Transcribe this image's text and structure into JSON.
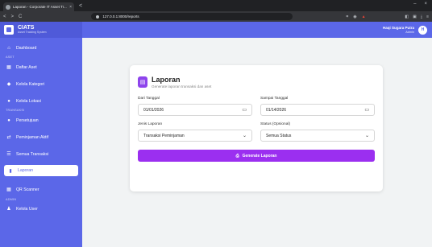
{
  "browser": {
    "tab_title": "Laporan - Corporate IT Asset Tr...",
    "tab_close": "×",
    "new_tab": "<",
    "nav_back": "<",
    "nav_forward": ">",
    "nav_reload": "C",
    "url": "127.0.0.1:8000/reports",
    "window_controls": [
      "–",
      "×"
    ]
  },
  "sidebar": {
    "brand_name": "CIATS",
    "brand_sub": "Asset Tracking System",
    "sections": {
      "asset": "ASET",
      "transaksi": "TRANSAKSI",
      "admin": "ADMIN"
    },
    "items": [
      {
        "label": "Dashboard",
        "icon": "home-icon",
        "glyph": "⌂"
      },
      {
        "label": "Daftar Aset",
        "icon": "boxes-icon",
        "glyph": "▦"
      },
      {
        "label": "Kelola Kategori",
        "icon": "tag-icon",
        "glyph": "◆"
      },
      {
        "label": "Kelola Lokasi",
        "icon": "location-icon",
        "glyph": "●"
      },
      {
        "label": "Persetujuan",
        "icon": "check-circle-icon",
        "glyph": "●"
      },
      {
        "label": "Peminjaman Aktif",
        "icon": "exchange-icon",
        "glyph": "⇄"
      },
      {
        "label": "Semua Transaksi",
        "icon": "list-icon",
        "glyph": "☰"
      },
      {
        "label": "Laporan",
        "icon": "file-icon",
        "glyph": "▮"
      },
      {
        "label": "QR Scanner",
        "icon": "qr-icon",
        "glyph": "▦"
      },
      {
        "label": "Kelola User",
        "icon": "users-icon",
        "glyph": "♟"
      }
    ]
  },
  "topbar": {
    "user_name": "Haqi Sugara Putra",
    "user_role": "Admin",
    "avatar_initial": "H"
  },
  "report": {
    "title": "Laporan",
    "subtitle": "Generate laporan transaksi dan aset",
    "from_label": "Dari Tanggal",
    "from_value": "01/01/2026",
    "to_label": "Sampai Tanggal",
    "to_value": "01/14/2026",
    "type_label": "Jenis Laporan",
    "type_value": "Transaksi Peminjaman",
    "status_label": "Status (Opsional)",
    "status_value": "Semua Status",
    "generate_label": "Generate Laporan"
  },
  "colors": {
    "sidebar": "#5b67e8",
    "accent_button": "#9b2ff0"
  }
}
